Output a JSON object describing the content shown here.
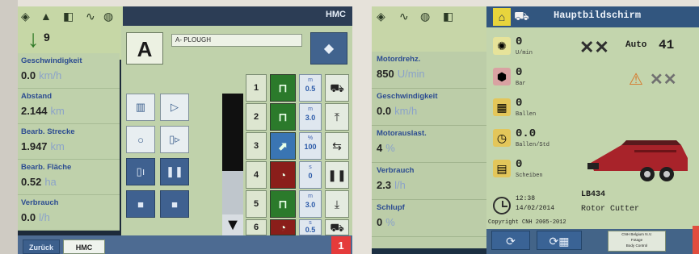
{
  "left_screen": {
    "header": {
      "title": "HMC",
      "count": "9"
    },
    "implement": {
      "letter": "A",
      "name": "A- PLOUGH"
    },
    "metrics": [
      {
        "label": "Geschwindigkeit",
        "value": "0.0",
        "unit": "km/h"
      },
      {
        "label": "Abstand",
        "value": "2.144",
        "unit": "km"
      },
      {
        "label": "Bearb. Strecke",
        "value": "1.947",
        "unit": "km"
      },
      {
        "label": "Bearb. Fläche",
        "value": "0.52",
        "unit": "ha"
      },
      {
        "label": "Verbrauch",
        "value": "0.0",
        "unit": "l/h"
      }
    ],
    "rows": [
      {
        "num": "1",
        "mode": "green",
        "unit": "m",
        "value": "0.5",
        "icon": "tractor-icon"
      },
      {
        "num": "2",
        "mode": "green",
        "unit": "m",
        "value": "3.0",
        "icon": "implement-lift-icon"
      },
      {
        "num": "3",
        "mode": "blue",
        "unit": "%",
        "value": "100",
        "icon": "hitch-icon"
      },
      {
        "num": "4",
        "mode": "red",
        "unit": "s",
        "value": "0",
        "icon": "pause-icon"
      },
      {
        "num": "5",
        "mode": "green",
        "unit": "m",
        "value": "3.0",
        "icon": "lower-icon"
      },
      {
        "num": "6",
        "mode": "red",
        "unit": "s",
        "value": "0.5",
        "icon": "tractor-icon"
      }
    ],
    "bottom_tabs": {
      "back": "Zurück",
      "hmc": "HMC"
    },
    "badge": "1"
  },
  "right_screen": {
    "title": "Hauptbildschirm",
    "side_metrics": [
      {
        "label": "Motordrehz.",
        "value": "850",
        "unit": "U/min"
      },
      {
        "label": "Geschwindigkeit",
        "value": "0.0",
        "unit": "km/h"
      },
      {
        "label": "Motorauslast.",
        "value": "4",
        "unit": "%"
      },
      {
        "label": "Verbrauch",
        "value": "2.3",
        "unit": "l/h"
      },
      {
        "label": "Schlupf",
        "value": "0",
        "unit": "%"
      }
    ],
    "items": [
      {
        "value": "0",
        "unit": "U/min"
      },
      {
        "value": "0",
        "unit": "Bar"
      },
      {
        "value": "0",
        "unit": "Ballen"
      },
      {
        "value": "0.0",
        "unit": "Ballen/Std"
      },
      {
        "value": "0",
        "unit": "Scheiben"
      }
    ],
    "auto": {
      "label": "Auto",
      "value": "41"
    },
    "clock": {
      "time": "12:38",
      "date": "14/02/2014"
    },
    "model": "LB434",
    "model_sub": "Rotor Cutter",
    "copyright": "Copyright CNH 2005-2012",
    "info_box": [
      "CNH Belgium N.V.",
      "Fotage",
      "Body Control"
    ]
  },
  "colors": {
    "accent_blue": "#32567f",
    "panel_green": "#c3d5ad",
    "badge_red": "#e53b3b"
  }
}
